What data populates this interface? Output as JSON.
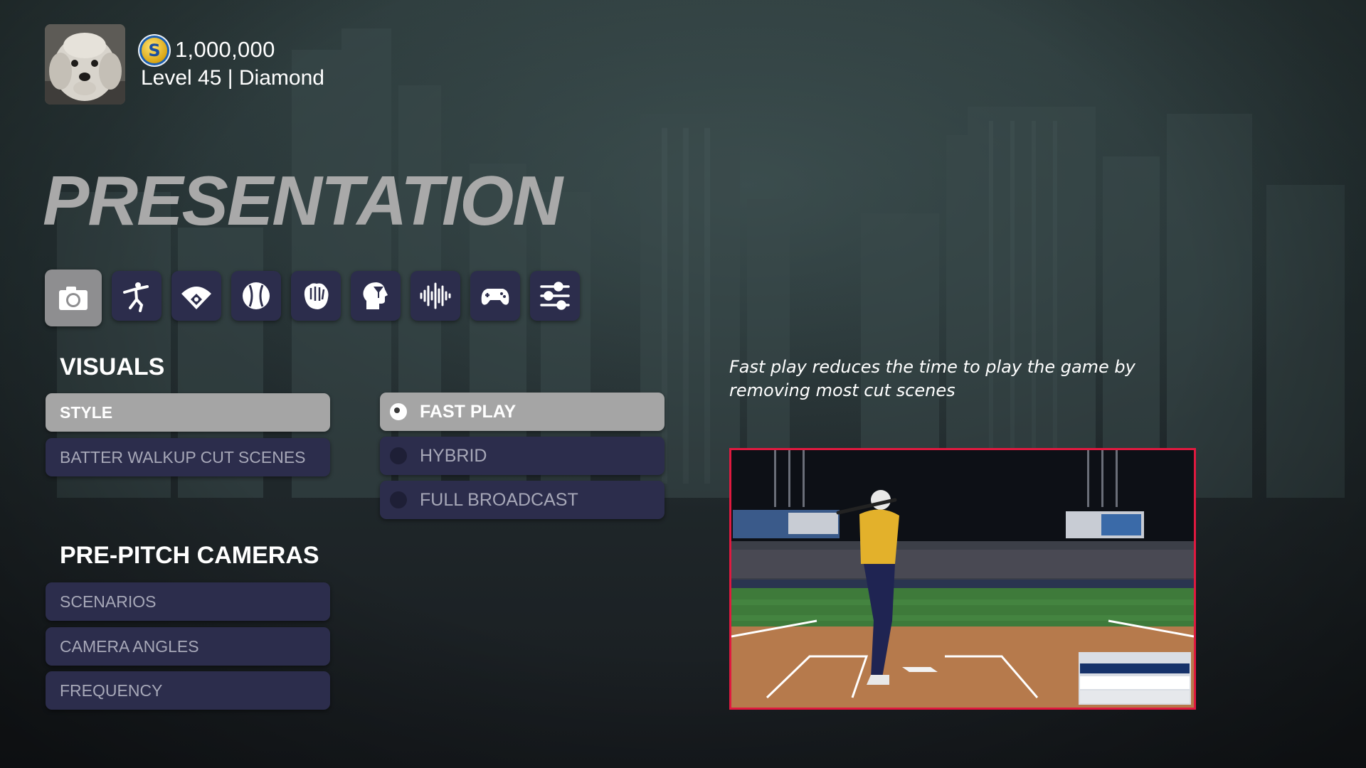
{
  "profile": {
    "currency_icon": "stubs-coin-icon",
    "currency_symbol": "S",
    "currency": "1,000,000",
    "level_text": "Level 45 | Diamond"
  },
  "page_title": "PRESENTATION",
  "tabs": [
    {
      "icon": "camera-icon",
      "active": true
    },
    {
      "icon": "batter-icon",
      "active": false
    },
    {
      "icon": "baseball-field-icon",
      "active": false
    },
    {
      "icon": "baseball-icon",
      "active": false
    },
    {
      "icon": "glove-icon",
      "active": false
    },
    {
      "icon": "strategy-head-icon",
      "active": false
    },
    {
      "icon": "audio-waveform-icon",
      "active": false
    },
    {
      "icon": "controller-icon",
      "active": false
    },
    {
      "icon": "sliders-icon",
      "active": false
    }
  ],
  "visuals": {
    "title": "VISUALS",
    "items": [
      "STYLE",
      "BATTER WALKUP CUT SCENES"
    ],
    "selected": "STYLE"
  },
  "style_options": {
    "items": [
      "FAST PLAY",
      "HYBRID",
      "FULL BROADCAST"
    ],
    "selected": "FAST PLAY"
  },
  "pre_pitch": {
    "title": "PRE-PITCH CAMERAS",
    "items": [
      "SCENARIOS",
      "CAMERA ANGLES",
      "FREQUENCY"
    ]
  },
  "description": "Fast play reduces the time to play the game by removing most cut scenes",
  "colors": {
    "accent_border": "#e0193f",
    "button_bg": "#2c2d4c",
    "button_active_bg": "#a5a5a5",
    "title_gray": "#a9a9a9"
  }
}
